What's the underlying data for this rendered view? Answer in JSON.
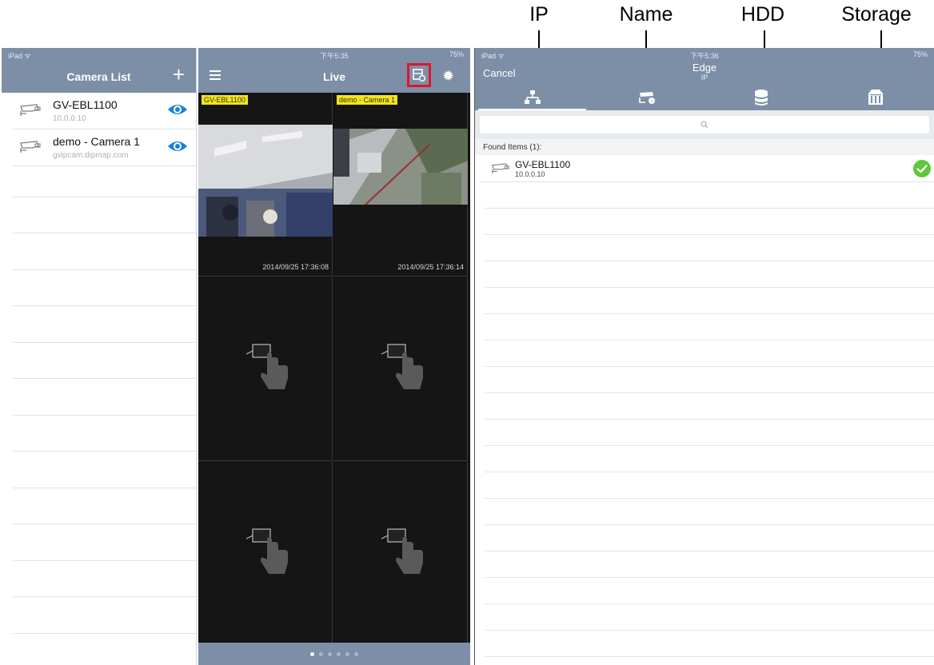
{
  "annotations": [
    "IP",
    "Name",
    "HDD",
    "Storage"
  ],
  "left_panel": {
    "status_left": "iPad ᯤ",
    "title": "Camera List",
    "add_label": "+",
    "cameras": [
      {
        "name": "GV-EBL1100",
        "address": "10.0.0.10"
      },
      {
        "name": "demo - Camera 1",
        "address": "gvipcam.dipmap.com"
      }
    ]
  },
  "mid_panel": {
    "status_time": "下午5:35",
    "status_battery": "75%",
    "title": "Live",
    "cells": [
      {
        "tag": "GV-EBL1100",
        "timestamp": "2014/09/25 17:36:08"
      },
      {
        "tag": "demo - Camera 1",
        "timestamp": "2014/09/25 17:36:14"
      }
    ],
    "page_dots": 6,
    "active_dot": 0
  },
  "right_panel": {
    "status_left": "iPad ᯤ",
    "status_time": "下午5:36",
    "status_battery": "75%",
    "cancel_label": "Cancel",
    "title": "Edge",
    "subtitle": "IP",
    "tabs": [
      "network-icon",
      "name-tag-icon",
      "hdd-icon",
      "storage-icon"
    ],
    "found_header": "Found Items (1):",
    "found": [
      {
        "name": "GV-EBL1100",
        "address": "10.0.0.10"
      }
    ]
  },
  "colors": {
    "navbar": "#7d8ea7",
    "eye": "#1a7fe0",
    "check": "#5cc83a",
    "highlight": "#e0152a",
    "tag": "#f3e51b"
  }
}
